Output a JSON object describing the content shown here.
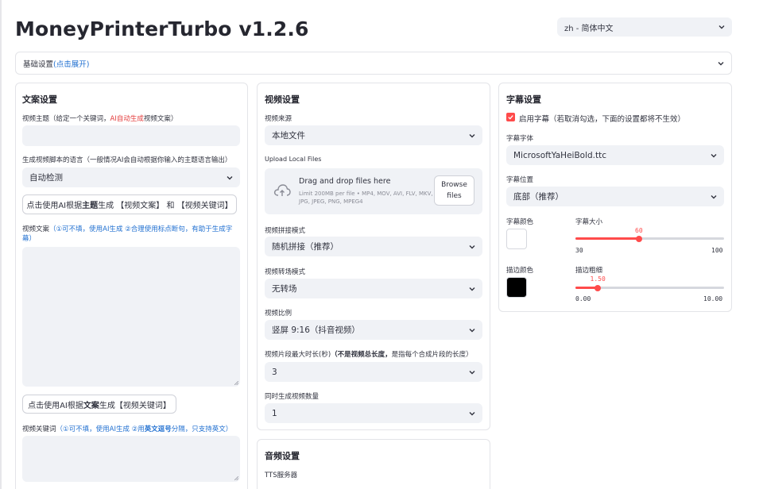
{
  "app": {
    "title": "MoneyPrinterTurbo v1.2.6"
  },
  "language_select": {
    "value": "zh - 简体中文"
  },
  "basic_settings": {
    "label": "基础设置",
    "hint": "(点击展开)"
  },
  "script_settings": {
    "heading": "文案设置",
    "subject_label_pre": "视频主题（给定一个关键词，",
    "subject_label_red": "AI自动生成",
    "subject_label_post": "视频文案）",
    "subject_value": "",
    "language_label": "生成视频脚本的语言（一般情况AI会自动根据你输入的主题语言输出）",
    "language_value": "自动检测",
    "gen_script_btn_pre": "点击使用AI根据",
    "gen_script_btn_bold": "主题",
    "gen_script_btn_post": "生成 【视频文案】 和 【视频关键词】",
    "script_label_pre": "视频文案",
    "script_label_hint": "（①可不填，使用AI生成 ②合理使用标点断句，有助于生成字幕）",
    "script_value": "",
    "gen_keywords_btn_pre": "点击使用AI根据",
    "gen_keywords_btn_bold": "文案",
    "gen_keywords_btn_post": "生成【视频关键词】",
    "keywords_label_pre": "视频关键词",
    "keywords_label_hint_a": "（①可不填，使用AI生成 ②用",
    "keywords_label_hint_b": "英文逗号",
    "keywords_label_hint_c": "分隔，只支持英文）",
    "keywords_value": ""
  },
  "video_settings": {
    "heading": "视频设置",
    "source_label": "视频来源",
    "source_value": "本地文件",
    "upload_label": "Upload Local Files",
    "drop_main": "Drag and drop files here",
    "drop_sub": "Limit 200MB per file • MP4, MOV, AVI, FLV, MKV, JPG, JPEG, PNG, MPEG4",
    "browse_line1": "Browse",
    "browse_line2": "files",
    "concat_label": "视频拼接模式",
    "concat_value": "随机拼接（推荐）",
    "transition_label": "视频转场模式",
    "transition_value": "无转场",
    "aspect_label": "视频比例",
    "aspect_value": "竖屏 9:16（抖音视频）",
    "clip_label_pre": "视频片段最大时长(秒)",
    "clip_label_bold": "（不是视频总长度，",
    "clip_label_post": "是指每个合成片段的长度）",
    "clip_value": "3",
    "count_label": "同时生成视频数量",
    "count_value": "1"
  },
  "audio_settings": {
    "heading": "音频设置",
    "tts_label": "TTS服务器"
  },
  "subtitle_settings": {
    "heading": "字幕设置",
    "enable_label": "启用字幕（若取消勾选，下面的设置都将不生效）",
    "font_label": "字幕字体",
    "font_value": "MicrosoftYaHeiBold.ttc",
    "position_label": "字幕位置",
    "position_value": "底部（推荐）",
    "color_label": "字幕颜色",
    "color_value": "#ffffff",
    "size_label": "字幕大小",
    "size_value": 60,
    "size_value_text": "60",
    "size_min": 30,
    "size_max": 100,
    "size_min_text": "30",
    "size_max_text": "100",
    "stroke_color_label": "描边颜色",
    "stroke_color_value": "#000000",
    "stroke_width_label": "描边粗细",
    "stroke_width_value": 1.5,
    "stroke_width_value_text": "1.50",
    "stroke_min": 0,
    "stroke_max": 10,
    "stroke_min_text": "0.00",
    "stroke_max_text": "10.00"
  },
  "colors": {
    "accent": "#ff4b4b",
    "input_bg": "#f0f2f6",
    "link": "#1f6fd0"
  }
}
